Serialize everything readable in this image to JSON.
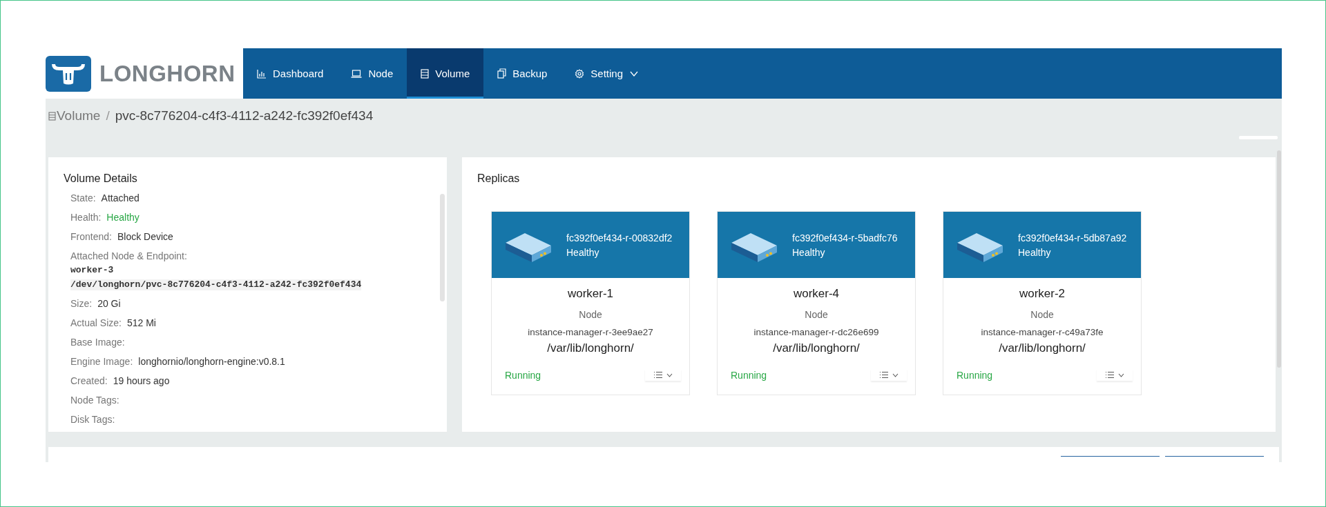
{
  "logo": {
    "text": "LONGHORN"
  },
  "nav": [
    {
      "label": "Dashboard",
      "kind": "chart",
      "selected": false,
      "has_menu": false
    },
    {
      "label": "Node",
      "kind": "laptop",
      "selected": false,
      "has_menu": false
    },
    {
      "label": "Volume",
      "kind": "database",
      "selected": true,
      "has_menu": false
    },
    {
      "label": "Backup",
      "kind": "copy",
      "selected": false,
      "has_menu": false
    },
    {
      "label": "Setting",
      "kind": "gear",
      "selected": false,
      "has_menu": true
    }
  ],
  "breadcrumb": {
    "parent": "Volume",
    "separator": "/",
    "current": "pvc-8c776204-c4f3-4112-a242-fc392f0ef434"
  },
  "details": {
    "title": "Volume Details",
    "fields": [
      {
        "label": "State:",
        "value": "Attached",
        "kind": "text"
      },
      {
        "label": "Health:",
        "value": "Healthy",
        "kind": "status"
      },
      {
        "label": "Frontend:",
        "value": "Block Device",
        "kind": "text"
      },
      {
        "label": "Attached Node & Endpoint:",
        "kind": "code",
        "lines": [
          "worker-3",
          "/dev/longhorn/pvc-8c776204-c4f3-4112-a242-fc392f0ef434"
        ]
      },
      {
        "label": "Size:",
        "value": "20 Gi",
        "kind": "text"
      },
      {
        "label": "Actual Size:",
        "value": "512 Mi",
        "kind": "text"
      },
      {
        "label": "Base Image:",
        "kind": "text"
      },
      {
        "label": "Engine Image:",
        "value": "longhornio/longhorn-engine:v0.8.1",
        "kind": "text"
      },
      {
        "label": "Created:",
        "value": "19 hours ago",
        "kind": "text"
      },
      {
        "label": "Node Tags:",
        "kind": "text"
      },
      {
        "label": "Disk Tags:",
        "kind": "text"
      }
    ]
  },
  "replicas": {
    "title": "Replicas",
    "items": [
      {
        "name": "fc392f0ef434-r-00832df2",
        "health": "Healthy",
        "node": "worker-1",
        "node_label": "Node",
        "instance_manager": "instance-manager-r-3ee9ae27",
        "path": "/var/lib/longhorn/",
        "status": "Running"
      },
      {
        "name": "fc392f0ef434-r-5badfc76",
        "health": "Healthy",
        "node": "worker-4",
        "node_label": "Node",
        "instance_manager": "instance-manager-r-dc26e699",
        "path": "/var/lib/longhorn/",
        "status": "Running"
      },
      {
        "name": "fc392f0ef434-r-5db87a92",
        "health": "Healthy",
        "node": "worker-2",
        "node_label": "Node",
        "instance_manager": "instance-manager-r-c49a73fe",
        "path": "/var/lib/longhorn/",
        "status": "Running"
      }
    ]
  }
}
